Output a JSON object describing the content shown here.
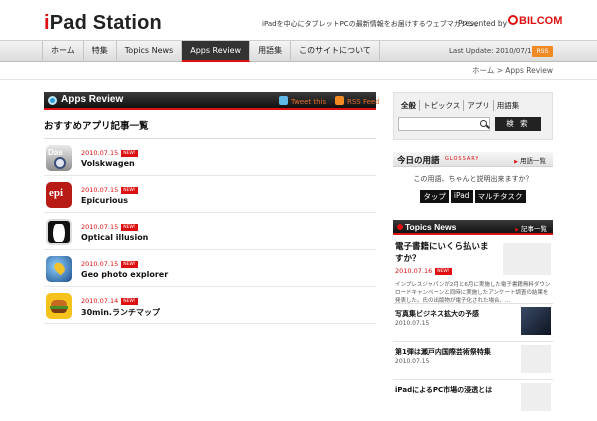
{
  "header": {
    "logo_i": "i",
    "logo_rest": "Pad Station",
    "tagline": "iPadを中心にタブレットPCの最新情報をお届けするウェブマガジン。",
    "presented_by": "Presented by",
    "brand": "BILCOM"
  },
  "nav": {
    "items": [
      "ホーム",
      "特集",
      "Topics News",
      "Apps Review",
      "用語集",
      "このサイトについて"
    ],
    "active_index": 3,
    "last_update": "Last Update: 2010/07/16",
    "rss": "RSS"
  },
  "breadcrumb": "ホーム > Apps Review",
  "main": {
    "section_title": "Apps Review",
    "tweet_label": "Tweet this",
    "rss_feed_label": "RSS Feed",
    "subtitle": "おすすめアプリ記事一覧",
    "apps": [
      {
        "date": "2010.07.15",
        "badge": "NEW!",
        "name": "Volskwagen",
        "icon": "das-auto-icon"
      },
      {
        "date": "2010.07.15",
        "badge": "NEW!",
        "name": "Epicurious",
        "icon": "epicurious-icon"
      },
      {
        "date": "2010.07.15",
        "badge": "NEW!",
        "name": "Optical  illusion",
        "icon": "optical-illusion-icon"
      },
      {
        "date": "2010.07.15",
        "badge": "NEW!",
        "name": "Geo photo explorer",
        "icon": "geo-globe-icon"
      },
      {
        "date": "2010.07.14",
        "badge": "NEW!",
        "name": "30min.ランチマップ",
        "icon": "burger-icon"
      }
    ],
    "das_text": "Das"
  },
  "sidebar": {
    "search_tabs": [
      "全般",
      "トピックス",
      "アプリ",
      "用語集"
    ],
    "search_button": "検 索",
    "term_title": "今日の用語",
    "term_glossary": "GLOSSARY",
    "term_more": "用語一覧",
    "term_question": "この用語、ちゃんと説明出来ますか？",
    "term_tags": [
      "タップ",
      "iPad",
      "マルチタスク"
    ],
    "topics_title": "Topics News",
    "topics_more": "記事一覧",
    "lead": {
      "title": "電子書籍にいくら払いますか？",
      "date": "2010.07.16",
      "badge": "NEW!",
      "desc": "インプレスジャパンが2月と6月に実施した電子書籍無料ダウンロードキャンペーンと同時に実施したアンケート調査の結果を発表した。氏の出版物が電子化された場合、..."
    },
    "topics": [
      {
        "title": "写真集ビジネス拡大の予感",
        "date": "2010.07.15"
      },
      {
        "title": "第1弾は瀬戸内国際芸術祭特集",
        "date": "2010.07.15"
      },
      {
        "title": "iPadによるPC市場の浸透とは",
        "date": ""
      }
    ]
  }
}
